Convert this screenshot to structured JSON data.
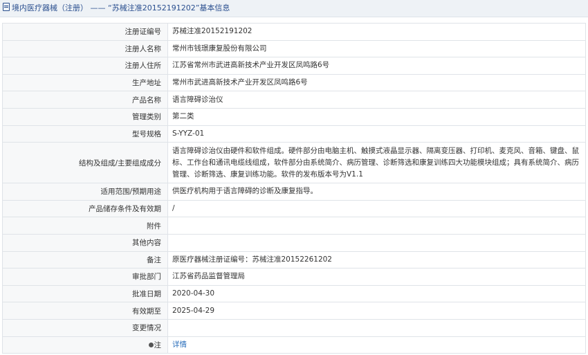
{
  "header": {
    "section": "境内医疗器械（注册）",
    "separator": "——",
    "quote_open": "“",
    "reg_no": "苏械注准20152191202",
    "quote_close": "”",
    "suffix": "基本信息"
  },
  "rows": [
    {
      "label": "注册证编号",
      "value": "苏械注准20152191202"
    },
    {
      "label": "注册人名称",
      "value": "常州市钱璟康复股份有限公司"
    },
    {
      "label": "注册人住所",
      "value": "江苏省常州市武进高新技术产业开发区凤鸣路6号"
    },
    {
      "label": "生产地址",
      "value": "常州市武进高新技术产业开发区凤鸣路6号"
    },
    {
      "label": "产品名称",
      "value": "语言障碍诊治仪"
    },
    {
      "label": "管理类别",
      "value": "第二类"
    },
    {
      "label": "型号规格",
      "value": "S-YYZ-01"
    },
    {
      "label": "结构及组成/主要组成成分",
      "value": "语言障碍诊治仪由硬件和软件组成。硬件部分由电脑主机、触摸式液晶显示器、隔离变压器、打印机、麦克风、音箱、键盘、鼠标、工作台和通讯电缆线组成，软件部分由系统简介、病历管理、诊断筛选和康复训练四大功能模块组成；具有系统简介、病历管理、诊断筛选、康复训练功能。软件的发布版本号为V1.1"
    },
    {
      "label": "适用范围/预期用途",
      "value": "供医疗机构用于语言障碍的诊断及康复指导。"
    },
    {
      "label": "产品储存条件及有效期",
      "value": "/"
    },
    {
      "label": "附件",
      "value": ""
    },
    {
      "label": "其他内容",
      "value": ""
    },
    {
      "label": "备注",
      "value": "原医疗器械注册证编号：苏械注准20152261202"
    },
    {
      "label": "审批部门",
      "value": "江苏省药品监督管理局"
    },
    {
      "label": "批准日期",
      "value": "2020-04-30"
    },
    {
      "label": "有效期至",
      "value": "2025-04-29"
    },
    {
      "label": "变更情况",
      "value": ""
    }
  ],
  "note_row": {
    "icon": "note-icon",
    "label": "注",
    "link_text": "详情"
  },
  "colors": {
    "header_bg": "#eef2f6",
    "header_text": "#2a4f8f",
    "label_bg": "#f7f8f9",
    "border": "#dfe3e8",
    "link": "#2a6ebb"
  }
}
